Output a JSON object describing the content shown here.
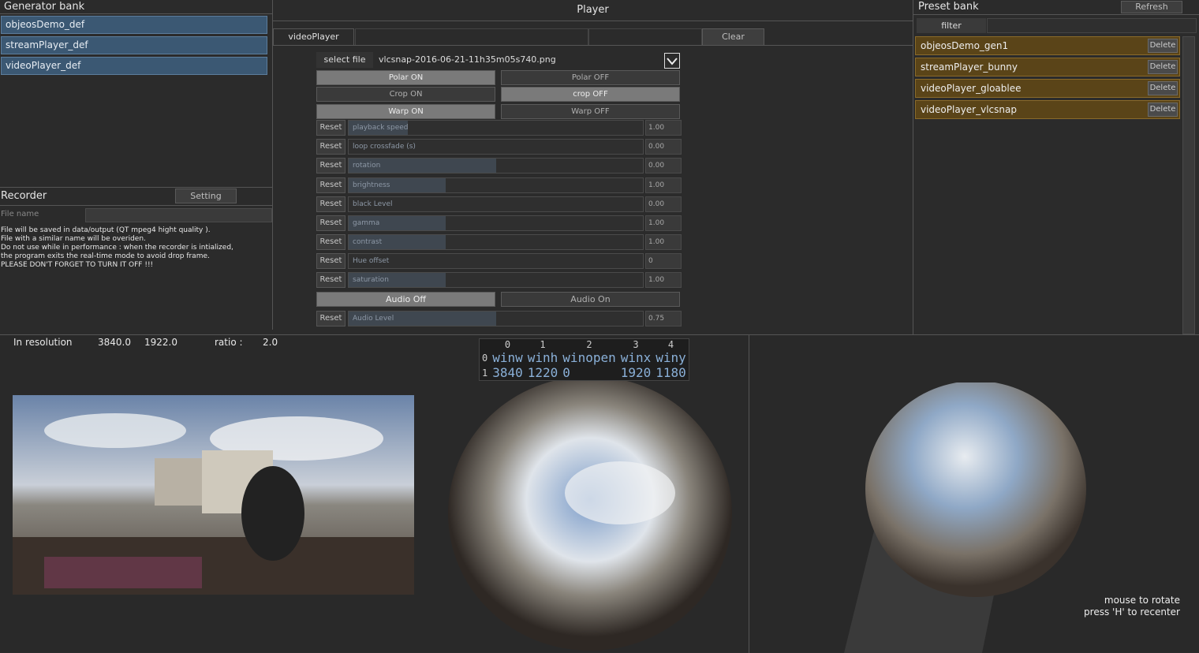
{
  "generator_bank": {
    "title": "Generator bank",
    "items": [
      "objeosDemo_def",
      "streamPlayer_def",
      "videoPlayer_def"
    ]
  },
  "recorder": {
    "title": "Recorder",
    "setting_label": "Setting",
    "file_name_label": "File name",
    "file_name_value": "",
    "notes": [
      "File will be saved in data/output (QT mpeg4 hight quality ).",
      "File with a similar name will be overiden.",
      "Do not use while in performance : when the recorder is intialized,",
      "the program exits the real-time mode to avoid drop frame.",
      "PLEASE DON'T FORGET TO TURN IT OFF !!!"
    ]
  },
  "player": {
    "title": "Player",
    "tab": "videoPlayer",
    "clear_label": "Clear",
    "select_file_label": "select file",
    "file_name": "vlcsnap-2016-06-21-11h35m05s740.png",
    "toggles": [
      {
        "on": "Polar ON",
        "off": "Polar OFF",
        "active": "on"
      },
      {
        "on": "Crop ON",
        "off": "crop OFF",
        "active": "off"
      },
      {
        "on": "Warp ON",
        "off": "Warp OFF",
        "active": "on"
      }
    ],
    "reset_label": "Reset",
    "sliders": [
      {
        "label": "playback speed",
        "value": "1.00",
        "fraction": 0.2
      },
      {
        "label": "loop crossfade (s)",
        "value": "0.00",
        "fraction": 0.0
      },
      {
        "label": "rotation",
        "value": "0.00",
        "fraction": 0.5
      },
      {
        "label": "brightness",
        "value": "1.00",
        "fraction": 0.33
      },
      {
        "label": "black Level",
        "value": "0.00",
        "fraction": 0.0
      },
      {
        "label": "gamma",
        "value": "1.00",
        "fraction": 0.33
      },
      {
        "label": "contrast",
        "value": "1.00",
        "fraction": 0.33
      },
      {
        "label": "Hue offset",
        "value": "0",
        "fraction": 0.0
      },
      {
        "label": "saturation",
        "value": "1.00",
        "fraction": 0.33
      }
    ],
    "audio": {
      "off": "Audio Off",
      "on": "Audio On",
      "active": "off"
    },
    "audio_slider": {
      "label": "Audio Level",
      "value": "0.75",
      "fraction": 0.5
    }
  },
  "preset_bank": {
    "title": "Preset bank",
    "refresh_label": "Refresh",
    "filter_label": "filter",
    "delete_label": "Delete",
    "items": [
      "objeosDemo_gen1",
      "streamPlayer_bunny",
      "videoPlayer_gloablee",
      "videoPlayer_vlcsnap"
    ]
  },
  "resolution": {
    "label": "In resolution",
    "width": "3840.0",
    "height": "1922.0",
    "ratio_label": "ratio :",
    "ratio": "2.0"
  },
  "window_table": {
    "columns": [
      "0",
      "1",
      "2",
      "3",
      "4"
    ],
    "rows": [
      {
        "index": "0",
        "cells": [
          "winw",
          "winh",
          "winopen",
          "winx",
          "winy"
        ]
      },
      {
        "index": "1",
        "cells": [
          "3840",
          "1220",
          "0",
          "1920",
          "1180"
        ]
      }
    ]
  },
  "sphere_view": {
    "hint1": "mouse to rotate",
    "hint2": "press 'H' to recenter"
  },
  "colors": {
    "generator_item": "#3b5873",
    "preset_item": "#5a4418",
    "background": "#2b2b2b"
  }
}
